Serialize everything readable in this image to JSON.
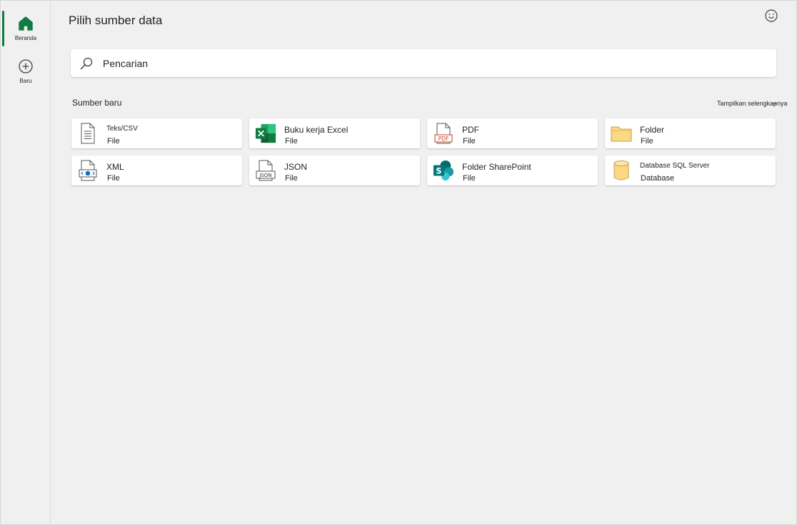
{
  "nav": {
    "home_label": "Beranda",
    "new_label": "Baru"
  },
  "colors": {
    "accent": "#107c41"
  },
  "page": {
    "title": "Pilih sumber data"
  },
  "search": {
    "placeholder": "Pencarian"
  },
  "section": {
    "title": "Sumber baru",
    "show_more": "Tampilkan selengkapnya"
  },
  "sources": [
    {
      "name": "Teks/CSV",
      "type": "File",
      "icon": "text-file-icon"
    },
    {
      "name": "Buku kerja Excel",
      "type": "File",
      "icon": "excel-icon"
    },
    {
      "name": "PDF",
      "type": "File",
      "icon": "pdf-icon"
    },
    {
      "name": "Folder",
      "type": "File",
      "icon": "folder-icon"
    },
    {
      "name": "XML",
      "type": "File",
      "icon": "xml-icon"
    },
    {
      "name": "JSON",
      "type": "File",
      "icon": "json-icon"
    },
    {
      "name": "Folder SharePoint",
      "type": "File",
      "icon": "sharepoint-icon"
    },
    {
      "name": "Database SQL Server",
      "type": "Database",
      "icon": "database-icon"
    }
  ]
}
